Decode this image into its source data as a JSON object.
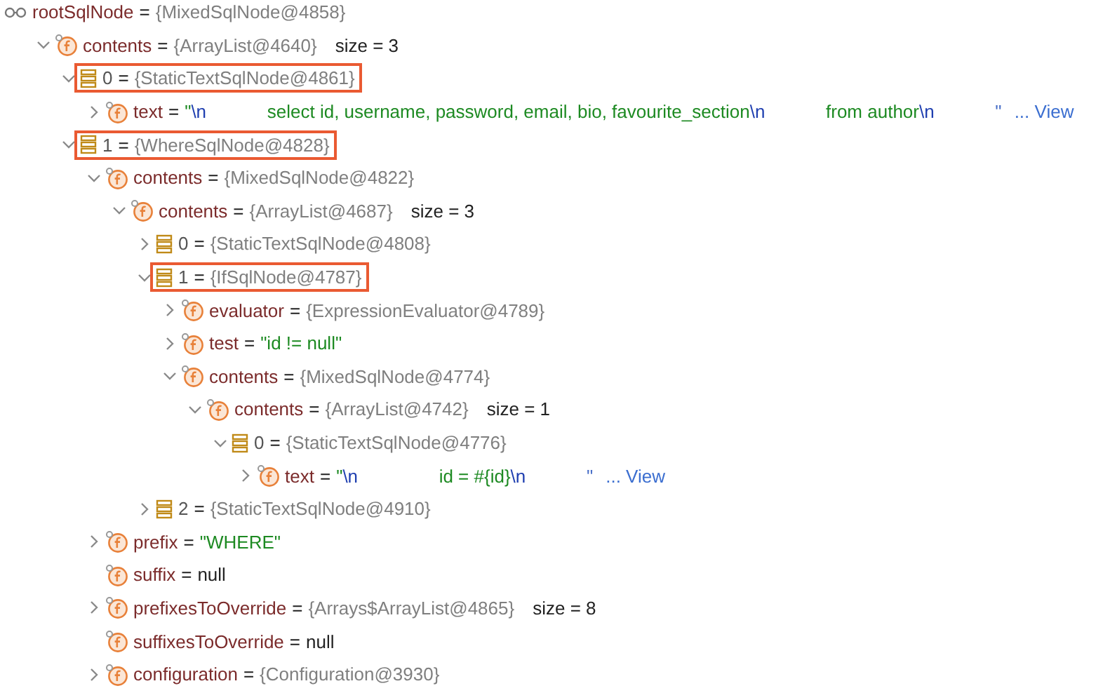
{
  "tree": [
    {
      "kind": "watch",
      "name": "rootSqlNode",
      "op": "=",
      "highlighted": false,
      "value": [
        {
          "kind": "ref",
          "text": "{MixedSqlNode@4858}"
        }
      ],
      "children": [
        {
          "kind": "field",
          "name": "contents",
          "op": "=",
          "highlighted": false,
          "expanded": true,
          "value": [
            {
              "kind": "ref",
              "text": "{ArrayList@4640}"
            }
          ],
          "size": "size = 3",
          "children": [
            {
              "kind": "element",
              "name": "0",
              "op": "=",
              "highlighted": true,
              "expanded": true,
              "value": [
                {
                  "kind": "ref",
                  "text": "{StaticTextSqlNode@4861}"
                }
              ],
              "children": [
                {
                  "kind": "field",
                  "name": "text",
                  "op": "=",
                  "highlighted": false,
                  "expanded": false,
                  "value": [
                    {
                      "kind": "string",
                      "text": "\""
                    },
                    {
                      "kind": "escape",
                      "text": "\\n"
                    },
                    {
                      "kind": "string",
                      "text": "            select id, username, password, email, bio, favourite_section"
                    },
                    {
                      "kind": "escape",
                      "text": "\\n"
                    },
                    {
                      "kind": "string",
                      "text": "            from author"
                    },
                    {
                      "kind": "escape",
                      "text": "\\n"
                    },
                    {
                      "kind": "tail",
                      "text": "            \""
                    }
                  ],
                  "link": "... View"
                }
              ]
            },
            {
              "kind": "element",
              "name": "1",
              "op": "=",
              "highlighted": true,
              "expanded": true,
              "value": [
                {
                  "kind": "ref",
                  "text": "{WhereSqlNode@4828}"
                }
              ],
              "children": [
                {
                  "kind": "field",
                  "name": "contents",
                  "op": "=",
                  "highlighted": false,
                  "expanded": true,
                  "value": [
                    {
                      "kind": "ref",
                      "text": "{MixedSqlNode@4822}"
                    }
                  ],
                  "children": [
                    {
                      "kind": "field",
                      "name": "contents",
                      "op": "=",
                      "highlighted": false,
                      "expanded": true,
                      "value": [
                        {
                          "kind": "ref",
                          "text": "{ArrayList@4687}"
                        }
                      ],
                      "size": "size = 3",
                      "children": [
                        {
                          "kind": "element",
                          "name": "0",
                          "op": "=",
                          "highlighted": false,
                          "expanded": false,
                          "value": [
                            {
                              "kind": "ref",
                              "text": "{StaticTextSqlNode@4808}"
                            }
                          ]
                        },
                        {
                          "kind": "element",
                          "name": "1",
                          "op": "=",
                          "highlighted": true,
                          "expanded": true,
                          "value": [
                            {
                              "kind": "ref",
                              "text": "{IfSqlNode@4787}"
                            }
                          ],
                          "children": [
                            {
                              "kind": "field",
                              "name": "evaluator",
                              "op": "=",
                              "highlighted": false,
                              "expanded": false,
                              "value": [
                                {
                                  "kind": "ref",
                                  "text": "{ExpressionEvaluator@4789}"
                                }
                              ]
                            },
                            {
                              "kind": "field",
                              "name": "test",
                              "op": "=",
                              "highlighted": false,
                              "expanded": false,
                              "value": [
                                {
                                  "kind": "string",
                                  "text": "\"id != null\""
                                }
                              ]
                            },
                            {
                              "kind": "field",
                              "name": "contents",
                              "op": "=",
                              "highlighted": false,
                              "expanded": true,
                              "value": [
                                {
                                  "kind": "ref",
                                  "text": "{MixedSqlNode@4774}"
                                }
                              ],
                              "children": [
                                {
                                  "kind": "field",
                                  "name": "contents",
                                  "op": "=",
                                  "highlighted": false,
                                  "expanded": true,
                                  "value": [
                                    {
                                      "kind": "ref",
                                      "text": "{ArrayList@4742}"
                                    }
                                  ],
                                  "size": "size = 1",
                                  "children": [
                                    {
                                      "kind": "element",
                                      "name": "0",
                                      "op": "=",
                                      "highlighted": false,
                                      "expanded": true,
                                      "value": [
                                        {
                                          "kind": "ref",
                                          "text": "{StaticTextSqlNode@4776}"
                                        }
                                      ],
                                      "children": [
                                        {
                                          "kind": "field",
                                          "name": "text",
                                          "op": "=",
                                          "highlighted": false,
                                          "expanded": false,
                                          "value": [
                                            {
                                              "kind": "string",
                                              "text": "\""
                                            },
                                            {
                                              "kind": "escape",
                                              "text": "\\n"
                                            },
                                            {
                                              "kind": "string",
                                              "text": "                id = #{id}"
                                            },
                                            {
                                              "kind": "escape",
                                              "text": "\\n"
                                            },
                                            {
                                              "kind": "tail",
                                              "text": "            \""
                                            }
                                          ],
                                          "link": "... View"
                                        }
                                      ]
                                    }
                                  ]
                                }
                              ]
                            }
                          ]
                        },
                        {
                          "kind": "element",
                          "name": "2",
                          "op": "=",
                          "highlighted": false,
                          "expanded": false,
                          "value": [
                            {
                              "kind": "ref",
                              "text": "{StaticTextSqlNode@4910}"
                            }
                          ]
                        }
                      ]
                    }
                  ]
                },
                {
                  "kind": "field",
                  "name": "prefix",
                  "op": "=",
                  "highlighted": false,
                  "expanded": false,
                  "value": [
                    {
                      "kind": "string",
                      "text": "\"WHERE\""
                    }
                  ]
                },
                {
                  "kind": "field",
                  "name": "suffix",
                  "op": "=",
                  "highlighted": false,
                  "value": [
                    {
                      "kind": "plain",
                      "text": "null"
                    }
                  ]
                },
                {
                  "kind": "field",
                  "name": "prefixesToOverride",
                  "op": "=",
                  "highlighted": false,
                  "expanded": false,
                  "value": [
                    {
                      "kind": "ref",
                      "text": "{Arrays$ArrayList@4865}"
                    }
                  ],
                  "size": "size = 8"
                },
                {
                  "kind": "field",
                  "name": "suffixesToOverride",
                  "op": "=",
                  "highlighted": false,
                  "value": [
                    {
                      "kind": "plain",
                      "text": "null"
                    }
                  ]
                },
                {
                  "kind": "field",
                  "name": "configuration",
                  "op": "=",
                  "highlighted": false,
                  "expanded": false,
                  "value": [
                    {
                      "kind": "ref",
                      "text": "{Configuration@3930}"
                    }
                  ]
                }
              ]
            }
          ]
        }
      ]
    }
  ]
}
